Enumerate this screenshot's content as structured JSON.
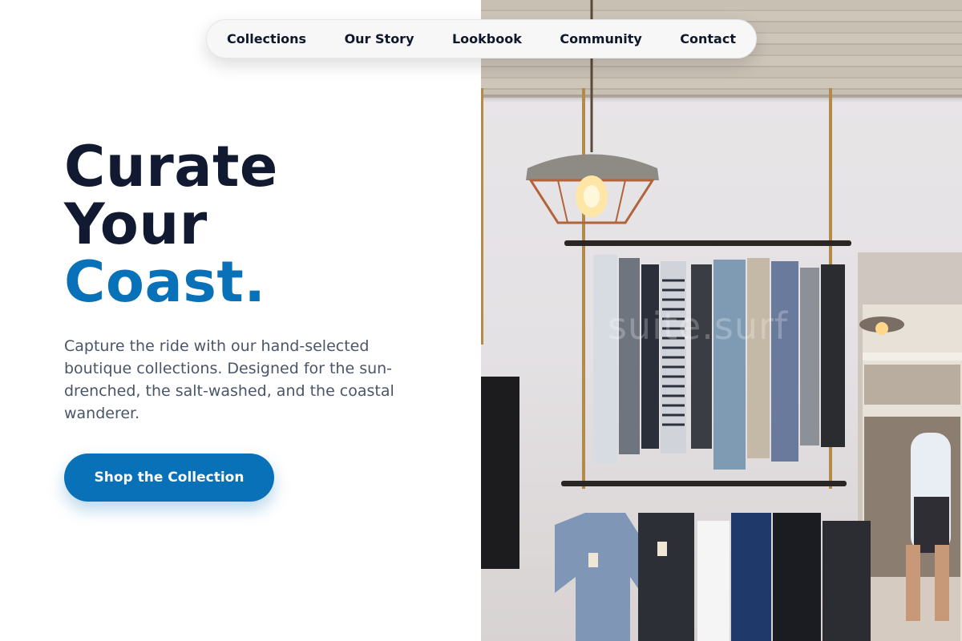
{
  "nav": {
    "items": [
      {
        "label": "Collections"
      },
      {
        "label": "Our Story"
      },
      {
        "label": "Lookbook"
      },
      {
        "label": "Community"
      },
      {
        "label": "Contact"
      }
    ]
  },
  "hero": {
    "headline_line1": "Curate",
    "headline_line2": "Your",
    "headline_accent": "Coast.",
    "subtext": "Capture the ride with our hand-selected boutique collections. Designed for the sun-drenched, the salt-washed, and the coastal wanderer.",
    "cta_label": "Shop the Collection"
  },
  "photo": {
    "subject": "boutique-clothing-rack-photo",
    "watermark": "suite.surf"
  },
  "colors": {
    "accent": "#0871b8",
    "headline": "#111a30",
    "body_text": "#4a5568",
    "nav_bg": "#f7f7f7"
  }
}
